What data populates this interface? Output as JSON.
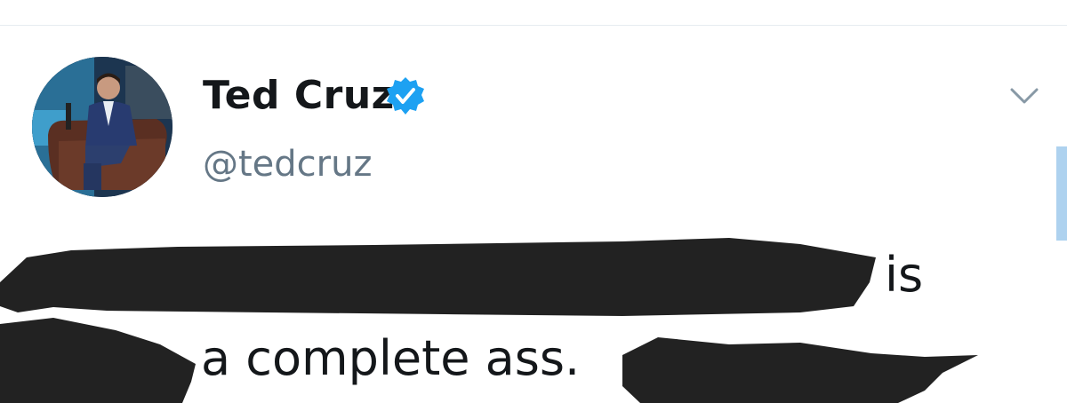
{
  "tweet": {
    "author_name": "Ted Cruz",
    "author_handle": "@tedcruz",
    "verified": true,
    "text_line1_visible": "is",
    "text_line2_visible": "a complete ass."
  },
  "icons": {
    "verified": "verified-badge-icon",
    "menu": "chevron-down-icon"
  },
  "colors": {
    "verified_blue": "#1da1f2",
    "handle_gray": "#657786",
    "divider": "#e6ecf0",
    "redaction": "#222222"
  }
}
